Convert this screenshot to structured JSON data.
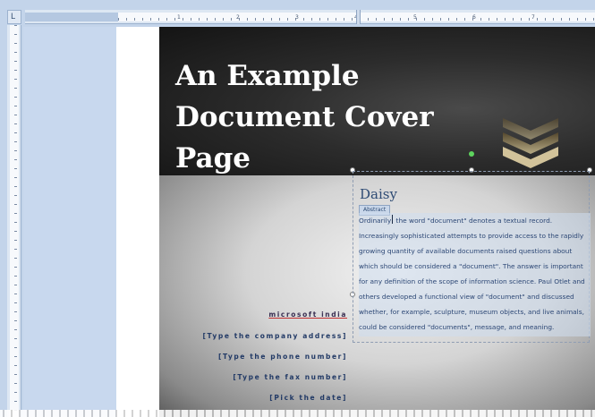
{
  "ruler": {
    "corner_glyph": "L",
    "numbers": [
      "1",
      "2",
      "3",
      "4",
      "5",
      "6",
      "7"
    ]
  },
  "cover": {
    "title": "An Example\nDocument Cover\nPage",
    "author": "Daisy",
    "abstract_tag": "Abstract",
    "abstract_before_cursor": "Ordinarily",
    "abstract_after_cursor": " the word \"document\" denotes a textual record. Increasingly sophisticated attempts to provide access to the rapidly growing quantity of available documents raised questions about which should be considered a \"document\". The answer is important for any definition of the scope of information science. Paul Otlet and others developed a functional view of \"document\" and discussed whether, for example, sculpture, museum objects, and live animals, could be considered \"documents\", message, and meaning.",
    "company_name": "microsoft india",
    "company_address": "[Type the company address]",
    "phone": "[Type the phone number]",
    "fax": "[Type the fax number]",
    "date": "[Pick the date]"
  },
  "colors": {
    "cover_dark": "#141414",
    "title_text": "#ffffff",
    "chevron_gold": "#c9b98c",
    "accent_blue": "#2e4b74",
    "ruler_blue": "#c3d4ea"
  },
  "icons": {
    "chevrons": "chevron-stack-icon",
    "rotate_handle": "rotate-handle-icon"
  }
}
